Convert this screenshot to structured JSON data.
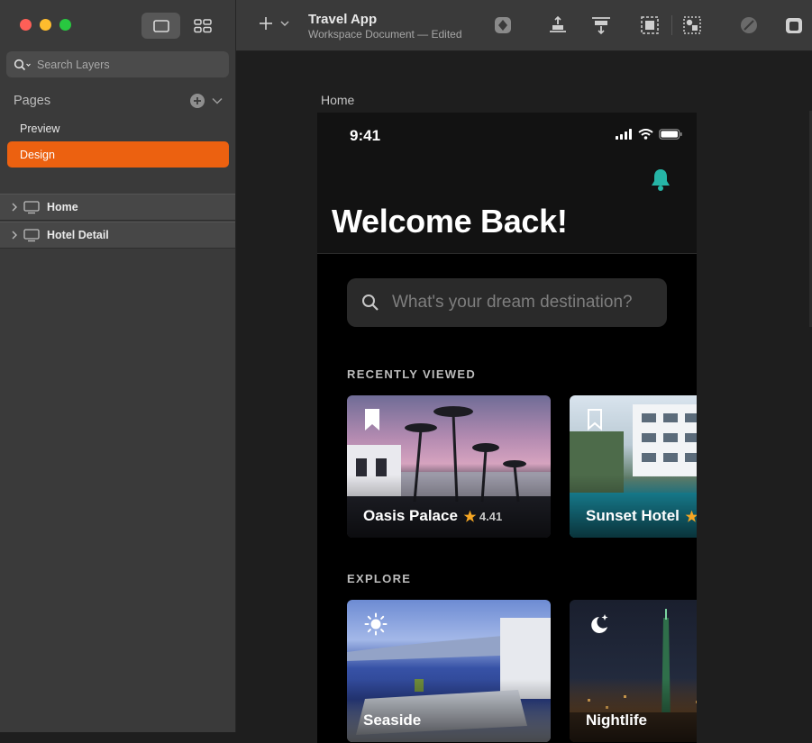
{
  "window": {
    "title": "Travel App",
    "subtitle": "Workspace Document — Edited"
  },
  "sidebar": {
    "search_placeholder": "Search Layers",
    "pages_title": "Pages",
    "pages": [
      {
        "label": "Preview",
        "selected": false
      },
      {
        "label": "Design",
        "selected": true
      }
    ],
    "layers": [
      {
        "label": "Home"
      },
      {
        "label": "Hotel Detail"
      }
    ]
  },
  "canvas": {
    "artboard_label": "Home"
  },
  "app": {
    "time": "9:41",
    "welcome": "Welcome Back!",
    "search_placeholder": "What's your dream destination?",
    "recent_title": "RECENTLY VIEWED",
    "recent": [
      {
        "name": "Oasis Palace",
        "rating": "4.41"
      },
      {
        "name": "Sunset Hotel"
      }
    ],
    "explore_title": "EXPLORE",
    "explore": [
      {
        "name": "Seaside",
        "icon": "sun-icon"
      },
      {
        "name": "Nightlife",
        "icon": "moon-stars-icon"
      }
    ]
  },
  "colors": {
    "accent": "#ec6110",
    "bell": "#26b5a6",
    "star": "#f5a623"
  }
}
